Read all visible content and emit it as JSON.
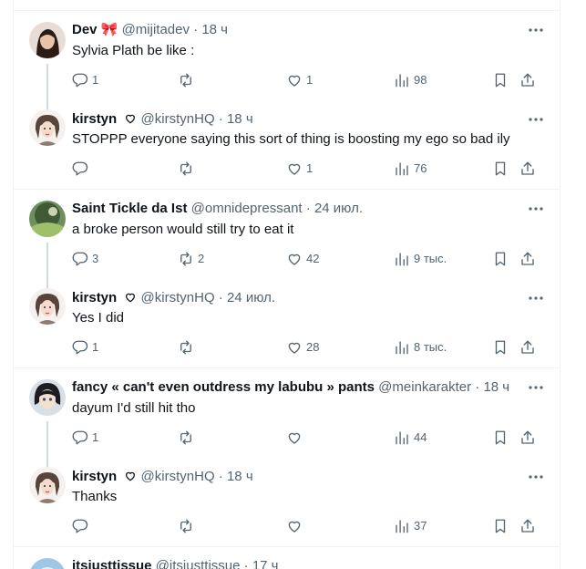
{
  "threads": [
    {
      "post": {
        "name": "Dev",
        "name_emoji": "🎀",
        "handle": "@mijitadev",
        "sep": "·",
        "time": "18 ч",
        "text": "Sylvia Plath be like :",
        "reply": "1",
        "repost": "",
        "like": "1",
        "views": "98",
        "avatar": "avatar-dev"
      },
      "reply": {
        "name": "kirstyn",
        "badge": "heart-outline",
        "handle": "@kirstynHQ",
        "sep": "·",
        "time": "18 ч",
        "text": "STOPPP everyone saying this sort of thing is boosting my ego so bad ily",
        "reply": "",
        "repost": "",
        "like": "1",
        "views": "76",
        "avatar": "avatar-kirstyn"
      }
    },
    {
      "post": {
        "name": "Saint Tickle da Ist",
        "handle": "@omnidepressant",
        "sep": "·",
        "time": "24 июл.",
        "text": "a broke person would still try to eat it",
        "reply": "3",
        "repost": "2",
        "like": "42",
        "views": "9 тыс.",
        "avatar": "avatar-saint"
      },
      "reply": {
        "name": "kirstyn",
        "badge": "heart-outline",
        "handle": "@kirstynHQ",
        "sep": "·",
        "time": "24 июл.",
        "text": "Yes I did",
        "reply": "1",
        "repost": "",
        "like": "28",
        "views": "8 тыс.",
        "avatar": "avatar-kirstyn"
      }
    },
    {
      "post": {
        "name": "fancy « can't even outdress my labubu » pants",
        "handle": "@meinkarakter",
        "sep": "·",
        "time": "18 ч",
        "text": "dayum I'd still hit tho",
        "reply": "1",
        "repost": "",
        "like": "",
        "views": "44",
        "avatar": "avatar-fancy"
      },
      "reply": {
        "name": "kirstyn",
        "badge": "heart-outline",
        "handle": "@kirstynHQ",
        "sep": "·",
        "time": "18 ч",
        "text": "Thanks",
        "reply": "",
        "repost": "",
        "like": "",
        "views": "37",
        "avatar": "avatar-kirstyn"
      }
    }
  ],
  "partial_post": {
    "name": "itsjusttissue",
    "handle": "@itsjusttissue",
    "sep": "·",
    "time": "17 ч"
  },
  "colors": {
    "text_primary": "#0f1419",
    "text_secondary": "#536471",
    "border": "#eff3f4",
    "thread_line": "#cfd9de",
    "icon": "#536471"
  }
}
